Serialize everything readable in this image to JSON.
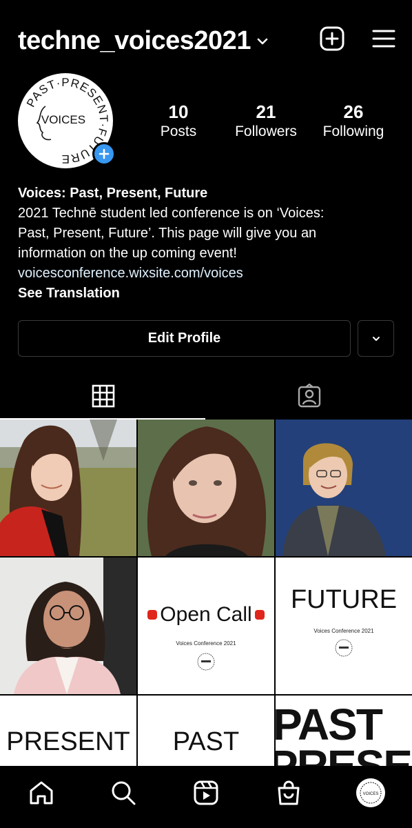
{
  "header": {
    "username": "techne_voices2021",
    "icons": [
      "chevron-down-icon",
      "new-post-icon",
      "menu-icon"
    ]
  },
  "profile": {
    "logo_text": {
      "ring": "PAST·PRESENT·FUTURE",
      "center": "VOICES"
    },
    "stats": [
      {
        "value": "10",
        "label": "Posts"
      },
      {
        "value": "21",
        "label": "Followers"
      },
      {
        "value": "26",
        "label": "Following"
      }
    ]
  },
  "bio": {
    "name": "Voices: Past, Present, Future",
    "line1": "2021 Technē student led conference is on ‘Voices:",
    "line2": "Past, Present, Future’. This page will give you an",
    "line3": "information on the up coming event!",
    "link": "voicesconference.wixsite.com/voices",
    "translate": "See Translation"
  },
  "actions": {
    "edit_profile": "Edit Profile"
  },
  "tabs": [
    "grid-icon",
    "tagged-icon"
  ],
  "posts": [
    {
      "kind": "photo",
      "desc": "woman-red-coat"
    },
    {
      "kind": "photo",
      "desc": "woman-portrait"
    },
    {
      "kind": "photo",
      "desc": "woman-blue-background"
    },
    {
      "kind": "photo",
      "desc": "man-glasses"
    },
    {
      "kind": "card",
      "big": "Open Call",
      "small": "Voices Conference 2021"
    },
    {
      "kind": "card",
      "big": "FUTURE",
      "small": "Voices Conference 2021"
    },
    {
      "kind": "card",
      "big": "PRESENT"
    },
    {
      "kind": "card",
      "big": "PAST"
    },
    {
      "kind": "card",
      "big": "PAST",
      "big2": "PRESENT"
    }
  ],
  "bottom_nav": [
    "home-icon",
    "search-icon",
    "reels-icon",
    "shop-icon",
    "profile-avatar"
  ]
}
